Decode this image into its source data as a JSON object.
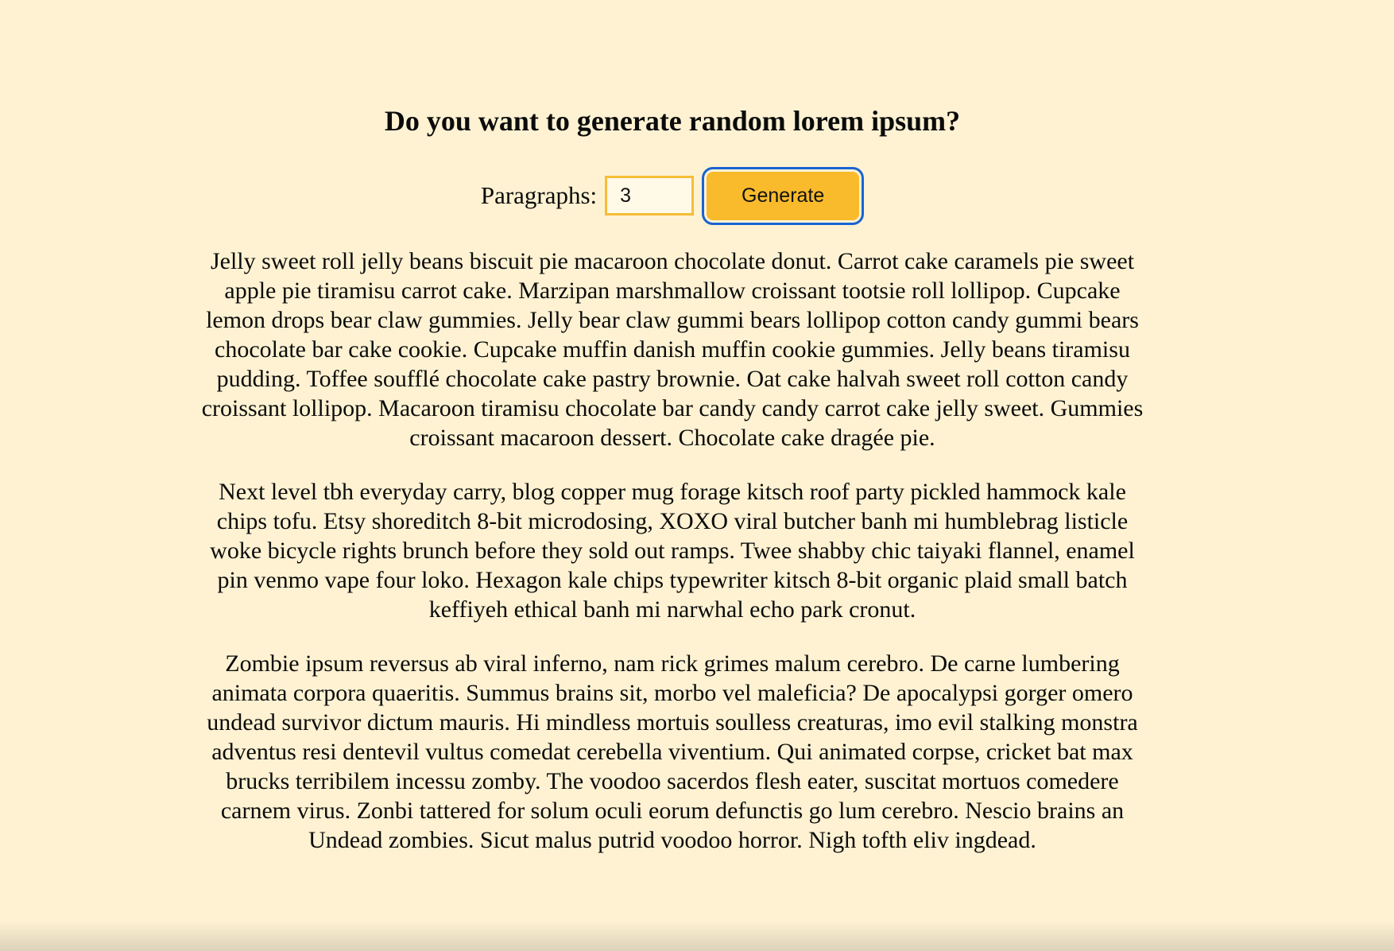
{
  "colors": {
    "background": "#fef2d2",
    "accent": "#f9bb2c",
    "focus_ring": "#1a63d4"
  },
  "header": {
    "title": "Do you want to generate random lorem ipsum?"
  },
  "form": {
    "label": "Paragraphs:",
    "input_value": "3",
    "button_label": "Generate"
  },
  "paragraphs": [
    "Jelly sweet roll jelly beans biscuit pie macaroon chocolate donut. Carrot cake caramels pie sweet apple pie tiramisu carrot cake. Marzipan marshmallow croissant tootsie roll lollipop. Cupcake lemon drops bear claw gummies. Jelly bear claw gummi bears lollipop cotton candy gummi bears chocolate bar cake cookie. Cupcake muffin danish muffin cookie gummies. Jelly beans tiramisu pudding. Toffee soufflé chocolate cake pastry brownie. Oat cake halvah sweet roll cotton candy croissant lollipop. Macaroon tiramisu chocolate bar candy candy carrot cake jelly sweet. Gummies croissant macaroon dessert. Chocolate cake dragée pie.",
    "Next level tbh everyday carry, blog copper mug forage kitsch roof party pickled hammock kale chips tofu. Etsy shoreditch 8-bit microdosing, XOXO viral butcher banh mi humblebrag listicle woke bicycle rights brunch before they sold out ramps. Twee shabby chic taiyaki flannel, enamel pin venmo vape four loko. Hexagon kale chips typewriter kitsch 8-bit organic plaid small batch keffiyeh ethical banh mi narwhal echo park cronut.",
    "Zombie ipsum reversus ab viral inferno, nam rick grimes malum cerebro. De carne lumbering animata corpora quaeritis. Summus brains sit, morbo vel maleficia? De apocalypsi gorger omero undead survivor dictum mauris. Hi mindless mortuis soulless creaturas, imo evil stalking monstra adventus resi dentevil vultus comedat cerebella viventium. Qui animated corpse, cricket bat max brucks terribilem incessu zomby. The voodoo sacerdos flesh eater, suscitat mortuos comedere carnem virus. Zonbi tattered for solum oculi eorum defunctis go lum cerebro. Nescio brains an Undead zombies. Sicut malus putrid voodoo horror. Nigh tofth eliv ingdead."
  ]
}
